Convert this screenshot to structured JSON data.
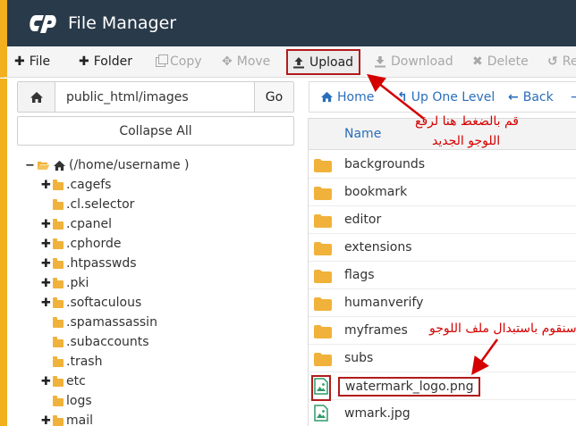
{
  "header": {
    "title": "File Manager",
    "logo_icon": "cpanel-logo-icon"
  },
  "toolbar": {
    "file": "File",
    "folder": "Folder",
    "copy": "Copy",
    "move": "Move",
    "upload": "Upload",
    "download": "Download",
    "delete": "Delete",
    "restore": "Re"
  },
  "left": {
    "path_value": "public_html/images",
    "go": "Go",
    "collapse": "Collapse All",
    "tree": {
      "root": "(/home/username )",
      "items": [
        ".cagefs",
        ".cl.selector",
        ".cpanel",
        ".cphorde",
        ".htpasswds",
        ".pki",
        ".softaculous",
        ".spamassassin",
        ".subaccounts",
        ".trash",
        "etc",
        "logs",
        "mail"
      ]
    }
  },
  "nav": {
    "home": "Home",
    "up": "Up One Level",
    "back": "Back"
  },
  "table": {
    "header": "Name",
    "rows": [
      "backgrounds",
      "bookmark",
      "editor",
      "extensions",
      "flags",
      "humanverify",
      "myframes",
      "subs",
      "watermark_logo.png",
      "wmark.jpg"
    ]
  },
  "annotations": {
    "upload_line1": "قم بالضغط هنا لرفع",
    "upload_line2": "اللوجو الجديد",
    "replace": "سنقوم باستبدال ملف اللوجو"
  },
  "colors": {
    "header_bg": "#293a4a",
    "accent": "#f2b01e",
    "link": "#2a6ebb",
    "annotation": "#d40000"
  }
}
